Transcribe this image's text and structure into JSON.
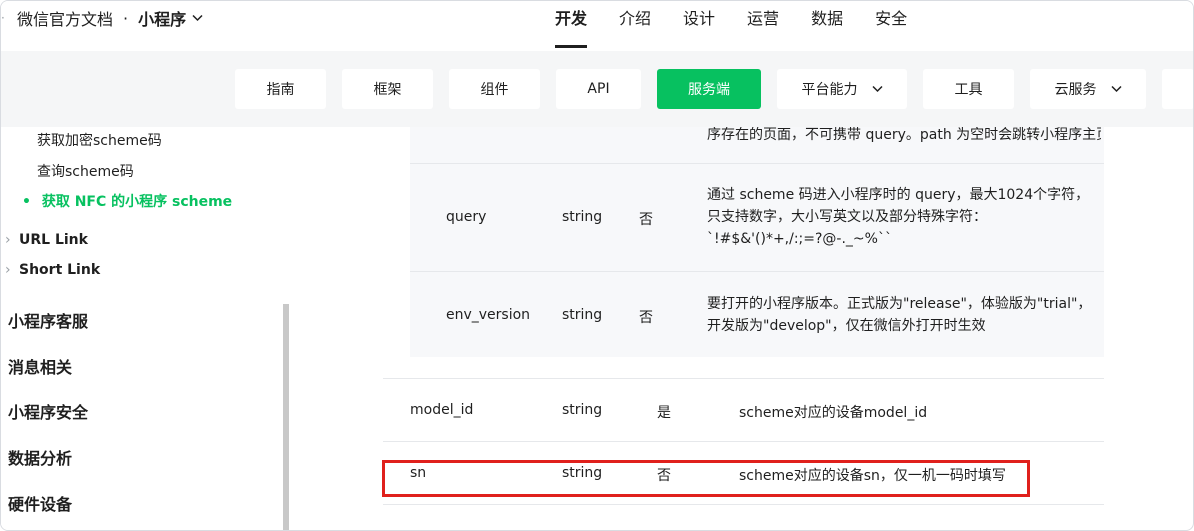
{
  "brand": {
    "name": "微信官方文档",
    "separator": "·",
    "product": "小程序",
    "chevron": "⌄"
  },
  "mainnav": [
    {
      "label": "开发",
      "active": true
    },
    {
      "label": "介绍"
    },
    {
      "label": "设计"
    },
    {
      "label": "运营"
    },
    {
      "label": "数据"
    },
    {
      "label": "安全"
    }
  ],
  "subnav": [
    {
      "label": "指南"
    },
    {
      "label": "框架"
    },
    {
      "label": "组件"
    },
    {
      "label": "API"
    },
    {
      "label": "服务端",
      "active": true
    },
    {
      "label": "平台能力",
      "chevron": "⌄"
    },
    {
      "label": "工具"
    },
    {
      "label": "云服务",
      "chevron": "⌄"
    }
  ],
  "sidebar": {
    "sub_items": [
      {
        "label": "获取加密scheme码"
      },
      {
        "label": "查询scheme码"
      },
      {
        "label": "获取 NFC 的小程序 scheme",
        "active": true,
        "bullet": "•"
      }
    ],
    "groups": [
      {
        "label": "URL Link",
        "arrow": "›"
      },
      {
        "label": "Short Link",
        "arrow": "›"
      }
    ],
    "top_items": [
      {
        "label": "小程序客服"
      },
      {
        "label": "消息相关"
      },
      {
        "label": "小程序安全"
      },
      {
        "label": "数据分析"
      },
      {
        "label": "硬件设备"
      }
    ]
  },
  "nested_table": {
    "partial_desc": "序存在的页面，不可携带 query。path 为空时会跳转小程序主页",
    "rows": [
      {
        "name": "query",
        "type": "string",
        "required": "否",
        "desc": "通过 scheme 码进入小程序时的 query，最大1024个字符，只支持数字，大小写英文以及部分特殊字符：`!#$&'()*+,/:;=?@-._~%``"
      },
      {
        "name": "env_version",
        "type": "string",
        "required": "否",
        "desc": "要打开的小程序版本。正式版为\"release\"，体验版为\"trial\"，开发版为\"develop\"，仅在微信外打开时生效"
      }
    ]
  },
  "outer_table": {
    "rows": [
      {
        "name": "model_id",
        "type": "string",
        "required": "是",
        "desc": "scheme对应的设备model_id"
      },
      {
        "name": "sn",
        "type": "string",
        "required": "否",
        "desc": "scheme对应的设备sn，仅一机一码时填写",
        "highlighted": true
      }
    ]
  },
  "colors": {
    "accent": "#07c160",
    "highlight_border": "#e0201c",
    "nested_bg": "#f7f8fa",
    "band_bg": "#f5f6f7"
  }
}
